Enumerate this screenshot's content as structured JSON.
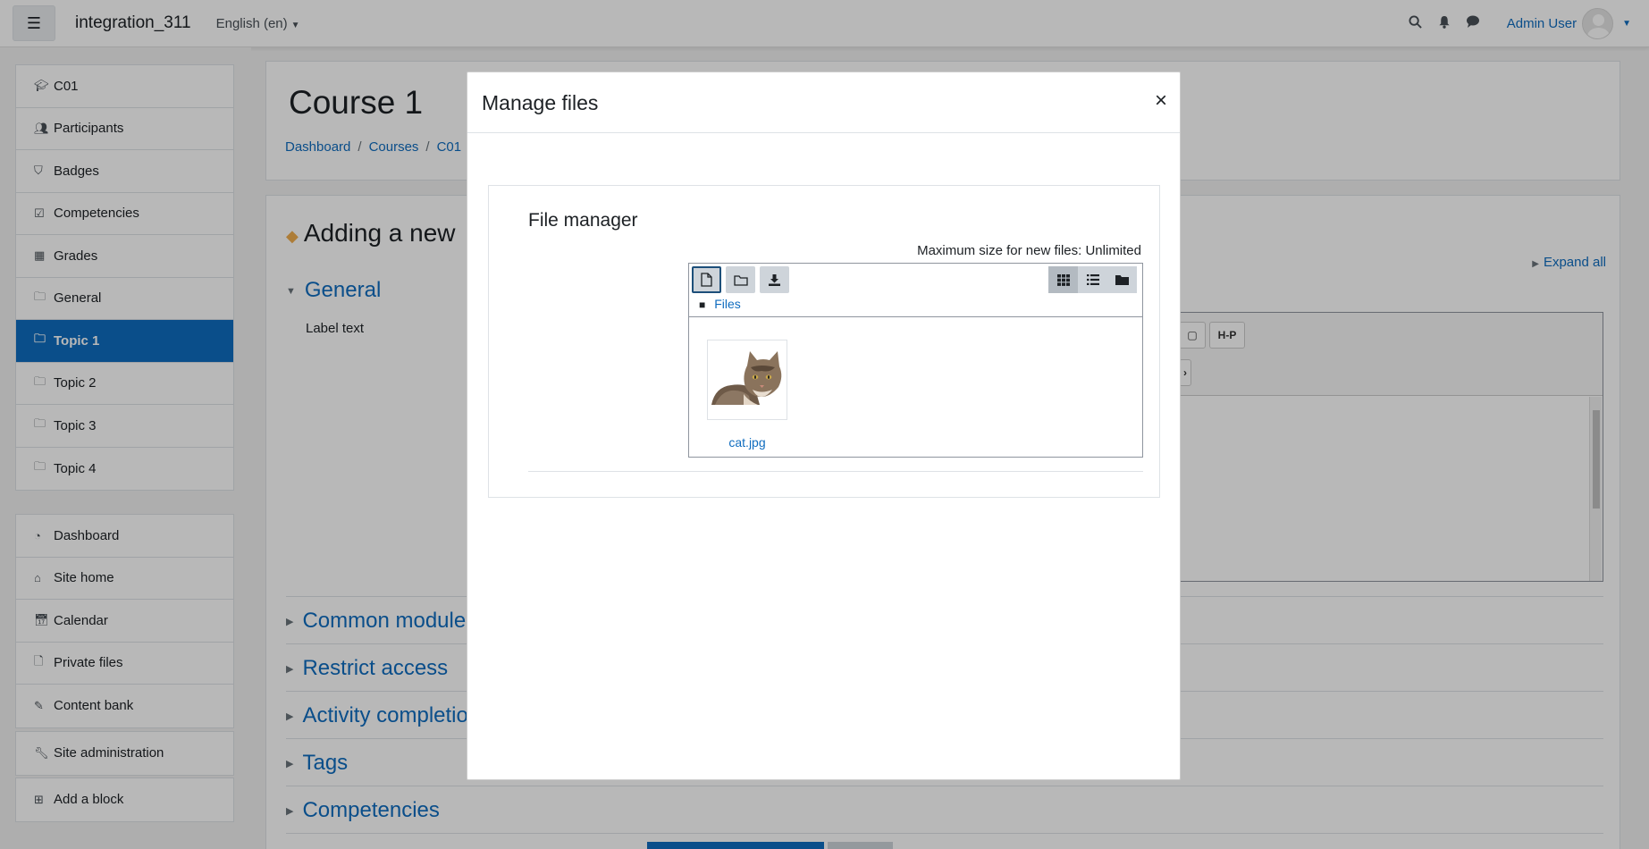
{
  "navbar": {
    "site_name": "integration_311",
    "language": "English (en)",
    "user_name": "Admin User"
  },
  "drawer": {
    "course_items": [
      {
        "label": "C01",
        "icon": "graduation-cap-icon"
      },
      {
        "label": "Participants",
        "icon": "users-icon"
      },
      {
        "label": "Badges",
        "icon": "shield-icon"
      },
      {
        "label": "Competencies",
        "icon": "check-square-icon"
      },
      {
        "label": "Grades",
        "icon": "table-icon"
      },
      {
        "label": "General",
        "icon": "folder-icon"
      },
      {
        "label": "Topic 1",
        "icon": "folder-icon",
        "active": true
      },
      {
        "label": "Topic 2",
        "icon": "folder-icon"
      },
      {
        "label": "Topic 3",
        "icon": "folder-icon"
      },
      {
        "label": "Topic 4",
        "icon": "folder-icon"
      }
    ],
    "site_items": [
      {
        "label": "Dashboard",
        "icon": "dashboard-icon"
      },
      {
        "label": "Site home",
        "icon": "home-icon"
      },
      {
        "label": "Calendar",
        "icon": "calendar-icon"
      },
      {
        "label": "Private files",
        "icon": "file-icon"
      },
      {
        "label": "Content bank",
        "icon": "brush-icon"
      }
    ],
    "admin_item": "Site administration",
    "add_block": "Add a block"
  },
  "page": {
    "course_title": "Course 1",
    "breadcrumb": [
      "Dashboard",
      "Courses",
      "C01"
    ],
    "adding_title": "Adding a new",
    "expand_all": "Expand all",
    "sections": [
      "General",
      "Common module",
      "Restrict access",
      "Activity completio",
      "Tags",
      "Competencies"
    ],
    "label_text": "Label text",
    "editor_h5p": "H-P"
  },
  "modal": {
    "title": "Manage files",
    "close": "×",
    "file_manager_title": "File manager",
    "max_size": "Maximum size for new files: Unlimited",
    "path_label": "Files",
    "files": [
      {
        "name": "cat.jpg"
      }
    ]
  },
  "colors": {
    "brand": "#0f6cbf",
    "active_nav": "#0f6cbf"
  }
}
